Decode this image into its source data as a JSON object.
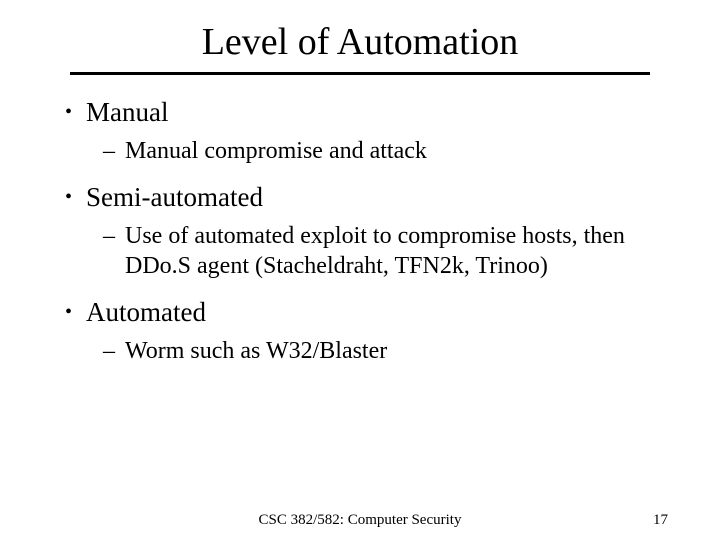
{
  "title": "Level of Automation",
  "bullets": [
    {
      "label": "Manual",
      "sub": "Manual compromise and attack"
    },
    {
      "label": "Semi-automated",
      "sub": "Use of automated exploit to compromise hosts, then DDo.S agent (Stacheldraht, TFN2k, Trinoo)"
    },
    {
      "label": "Automated",
      "sub": "Worm such as W32/Blaster"
    }
  ],
  "footer": {
    "center": "CSC 382/582: Computer Security",
    "page": "17"
  }
}
